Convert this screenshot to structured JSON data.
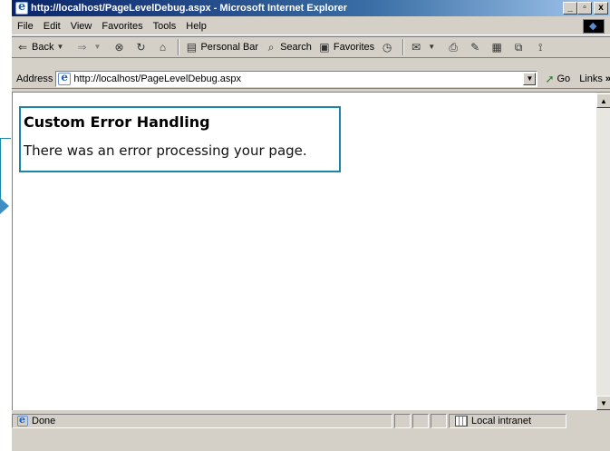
{
  "window": {
    "title": "http://localhost/PageLevelDebug.aspx - Microsoft Internet Explorer",
    "controls": {
      "minimize": "_",
      "maximize": "▫",
      "close": "x"
    }
  },
  "menu": {
    "items": [
      "File",
      "Edit",
      "View",
      "Favorites",
      "Tools",
      "Help"
    ]
  },
  "toolbar": {
    "back": "Back",
    "personal_bar": "Personal Bar",
    "search": "Search",
    "favorites": "Favorites"
  },
  "address": {
    "label": "Address",
    "url": "http://localhost/PageLevelDebug.aspx",
    "go": "Go",
    "links": "Links",
    "links_chevron": "»"
  },
  "page": {
    "heading": "Custom Error Handling",
    "message": "There was an error processing your page."
  },
  "status": {
    "text": "Done",
    "zone": "Local intranet"
  },
  "colors": {
    "titlebar_start": "#0a246a",
    "titlebar_end": "#a6caf0",
    "callout": "#1b87a7",
    "chrome": "#d4d0c8"
  }
}
